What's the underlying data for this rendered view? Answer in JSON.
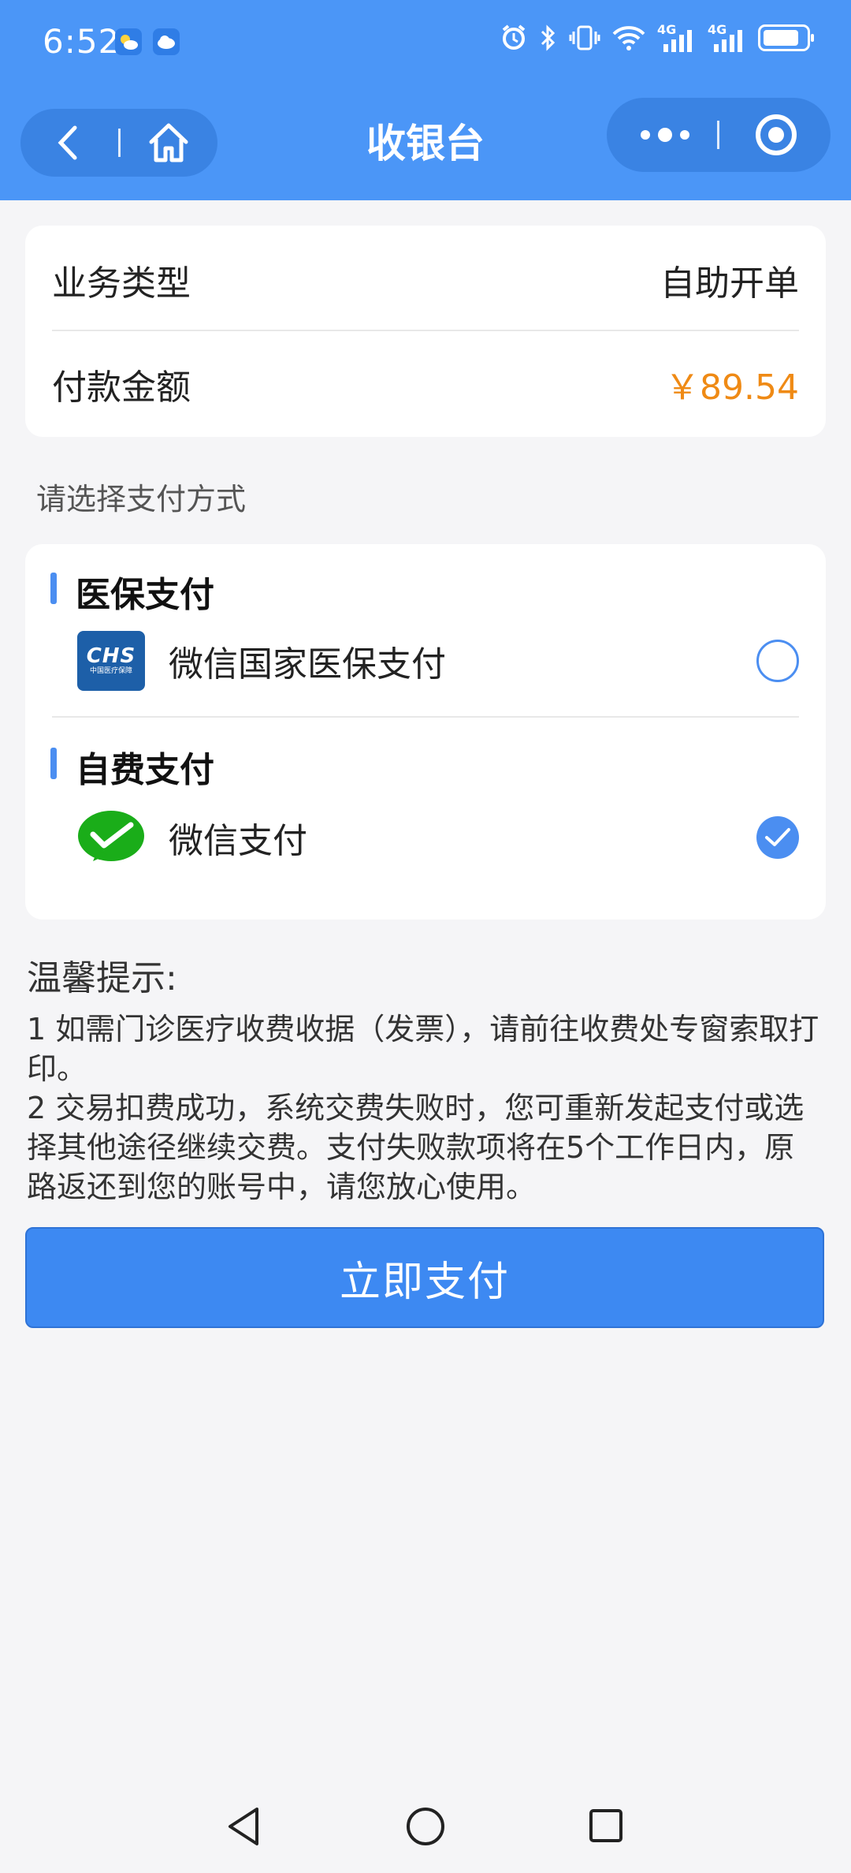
{
  "status_bar": {
    "time": "6:52",
    "signal_1": "4G",
    "signal_2": "4G"
  },
  "nav": {
    "title": "收银台",
    "back_icon": "chevron-left-icon",
    "home_icon": "home-icon",
    "more_icon": "more-dots-icon",
    "close_icon": "target-circle-icon"
  },
  "order": {
    "business_type_label": "业务类型",
    "business_type_value": "自助开单",
    "amount_label": "付款金额",
    "amount_value": "￥89.54"
  },
  "payment": {
    "prompt": "请选择支付方式",
    "groups": [
      {
        "title": "医保支付",
        "option": "微信国家医保支付",
        "selected": false,
        "logo_text": "CHS",
        "logo_sub": "中国医疗保障"
      },
      {
        "title": "自费支付",
        "option": "微信支付",
        "selected": true
      }
    ]
  },
  "tips": {
    "title": "温馨提示:",
    "line1": "1 如需门诊医疗收费收据（发票），请前往收费处专窗索取打印。",
    "line2": "2 交易扣费成功，系统交费失败时，您可重新发起支付或选择其他途径继续交费。支付失败款项将在5个工作日内，原路返还到您的账号中，请您放心使用。"
  },
  "actions": {
    "pay_now": "立即支付"
  },
  "colors": {
    "primary": "#4b96f7",
    "amount": "#ef8a15",
    "wechat_green": "#1aad19"
  }
}
